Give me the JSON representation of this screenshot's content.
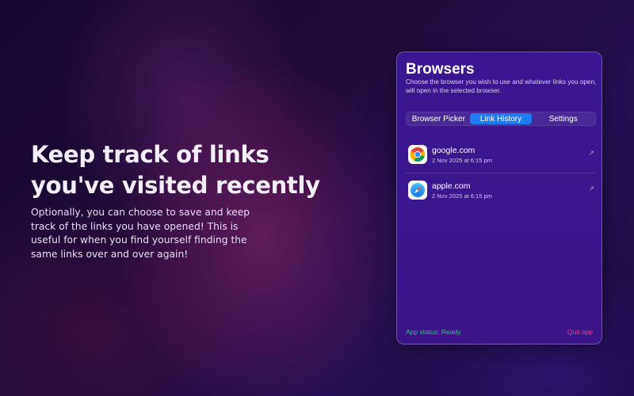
{
  "promo": {
    "headline": "Keep track of links you've visited recently",
    "body": "Optionally, you can choose to save and keep track of the links you have opened! This is useful for when you find yourself finding the same links over and over again!"
  },
  "panel": {
    "title": "Browsers",
    "description": "Choose the browser you wish to use and whatever links you open, will open in the selected browser.",
    "tabs": [
      {
        "label": "Browser Picker",
        "active": false
      },
      {
        "label": "Link History",
        "active": true
      },
      {
        "label": "Settings",
        "active": false
      }
    ],
    "history": [
      {
        "site": "google.com",
        "time": "2 Nov 2025 at 6:15 pm",
        "icon": "chrome-icon",
        "open_icon": "↗"
      },
      {
        "site": "apple.com",
        "time": "2 Nov 2025 at 6:15 pm",
        "icon": "safari-icon",
        "open_icon": "↗"
      }
    ],
    "status": "App status: Ready",
    "quit_label": "Quit app"
  },
  "colors": {
    "accent": "#1d7cf2",
    "status_ready": "#3dbb7c",
    "quit": "#e0457a",
    "panel_bg": "#3a178c"
  }
}
